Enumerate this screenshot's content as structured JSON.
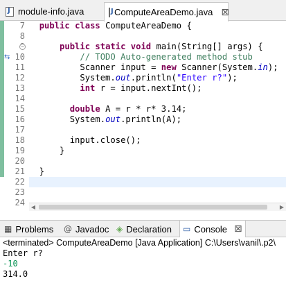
{
  "editor_tabs": [
    {
      "label": "module-info.java",
      "active": false
    },
    {
      "label": "ComputeAreaDemo.java",
      "active": true,
      "close": "⊠"
    }
  ],
  "line_numbers": [
    "7",
    "8",
    "9",
    "10",
    "11",
    "12",
    "13",
    "14",
    "15",
    "16",
    "17",
    "18",
    "19",
    "20",
    "21",
    "22",
    "23",
    "24"
  ],
  "code": {
    "l7": {
      "indent": "  ",
      "kw1": "public",
      "sp1": " ",
      "kw2": "class",
      "rest": " ComputeAreaDemo {"
    },
    "l9": {
      "indent": "      ",
      "kw1": "public",
      "kw2": "static",
      "kw3": "void",
      "rest": " main(String[] args) {"
    },
    "l10": {
      "indent": "          ",
      "comment": "// TODO Auto-generated method stub"
    },
    "l11": {
      "indent": "          ",
      "a": "Scanner input = ",
      "kw": "new",
      "b": " Scanner(System.",
      "field": "in",
      "c": ");"
    },
    "l12": {
      "indent": "          ",
      "a": "System.",
      "field": "out",
      "b": ".println(",
      "str": "\"Enter r?\"",
      "c": ");"
    },
    "l13": {
      "indent": "          ",
      "kw": "int",
      "a": " r = input.nextInt();"
    },
    "l15": {
      "indent": "        ",
      "kw": "double",
      "a": " A = r * r* 3.14;"
    },
    "l16": {
      "indent": "        ",
      "a": "System.",
      "field": "out",
      "b": ".println(A);"
    },
    "l18": {
      "indent": "        ",
      "a": "input.close();"
    },
    "l19": {
      "indent": "      ",
      "a": "}"
    },
    "l21": {
      "indent": "  ",
      "a": "}"
    }
  },
  "bottom_tabs": {
    "problems": "Problems",
    "javadoc": "Javadoc",
    "declaration": "Declaration",
    "console": "Console",
    "console_close": "⊠"
  },
  "console": {
    "terminated": "<terminated> ComputeAreaDemo [Java Application] C:\\Users\\vanil\\.p2\\",
    "lines": [
      {
        "text": "Enter r?",
        "color": "#000000"
      },
      {
        "text": "-10",
        "color": "#008f4f"
      },
      {
        "text": "314.0",
        "color": "#000000"
      }
    ]
  },
  "colors": {
    "keyword": "#7f0055",
    "comment": "#3f7f5f",
    "string": "#2a00ff",
    "field": "#0000c0",
    "input": "#008f4f"
  }
}
